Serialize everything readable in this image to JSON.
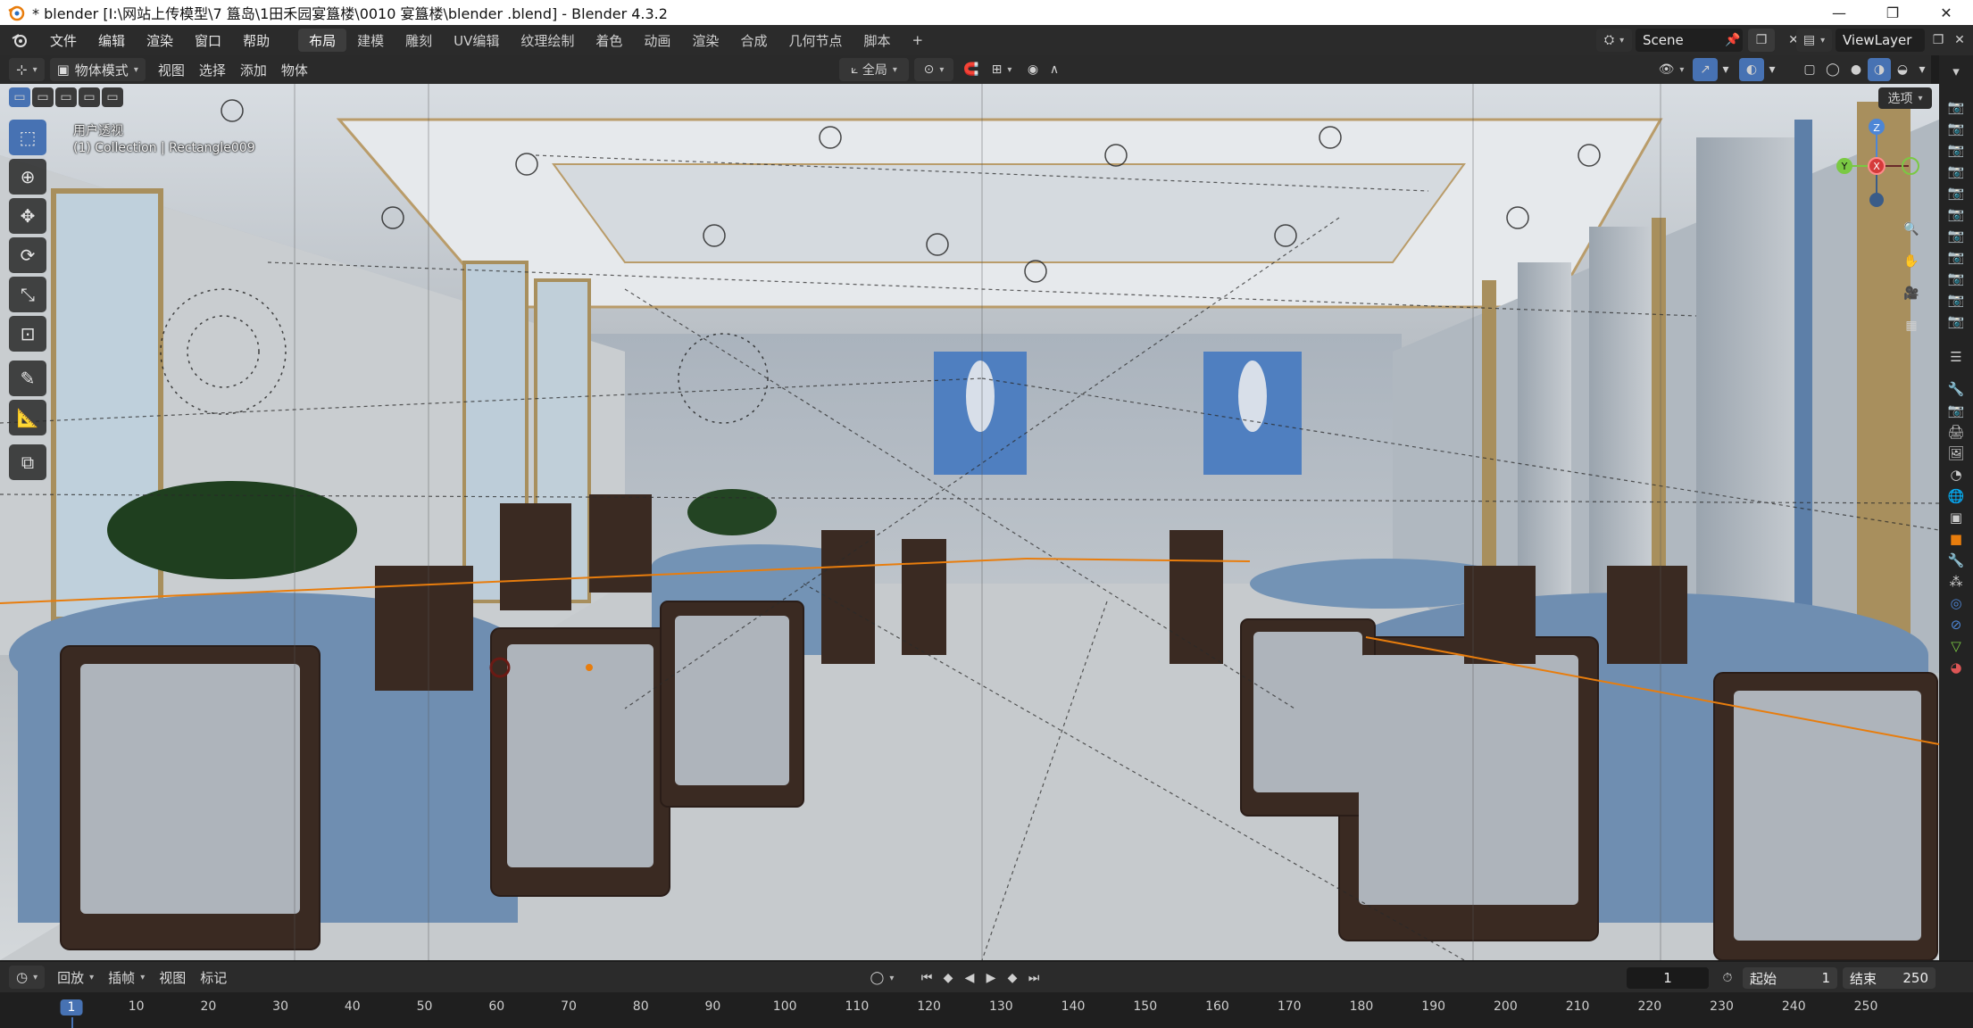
{
  "window": {
    "title": "* blender  [I:\\网站上传模型\\7 簋岛\\1田禾园宴簋楼\\0010 宴簋楼\\blender .blend] - Blender 4.3.2",
    "controls": [
      "—",
      "❐",
      "✕"
    ]
  },
  "menubar": {
    "items": [
      "文件",
      "编辑",
      "渲染",
      "窗口",
      "帮助"
    ],
    "workspaces": [
      "布局",
      "建模",
      "雕刻",
      "UV编辑",
      "纹理绘制",
      "着色",
      "动画",
      "渲染",
      "合成",
      "几何节点",
      "脚本",
      "+"
    ],
    "active_workspace": "布局",
    "scene": "Scene",
    "view_layer": "ViewLayer"
  },
  "viewport_header": {
    "mode": "物体模式",
    "menus": [
      "视图",
      "选择",
      "添加",
      "物体"
    ],
    "orientation": "全局",
    "options_label": "选项"
  },
  "viewport": {
    "view_name": "用户透视",
    "collection_info": "(1) Collection | Rectangle009",
    "gizmo_axes": [
      "Z",
      "Y",
      "X"
    ]
  },
  "toolbar": {
    "tools": [
      "select-box",
      "cursor",
      "move",
      "rotate",
      "scale",
      "transform",
      "annotate",
      "measure",
      "add-cube"
    ]
  },
  "timeline": {
    "menus": [
      "回放",
      "插帧",
      "视图",
      "标记"
    ],
    "current_frame": "1",
    "start_label": "起始",
    "start_value": "1",
    "end_label": "结束",
    "end_value": "250",
    "ruler": [
      "1",
      "10",
      "20",
      "30",
      "40",
      "50",
      "60",
      "70",
      "80",
      "90",
      "100",
      "110",
      "120",
      "130",
      "140",
      "150",
      "160",
      "170",
      "180",
      "190",
      "200",
      "210",
      "220",
      "230",
      "240",
      "250"
    ]
  },
  "colors": {
    "accent": "#4772b3",
    "orange_selection": "#e87d0d"
  }
}
